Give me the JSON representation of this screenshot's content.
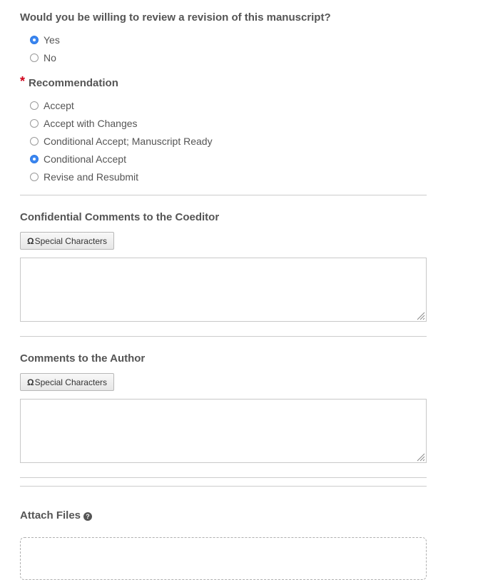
{
  "revision_question": {
    "label": "Would you be willing to review a revision of this manuscript?",
    "options": [
      {
        "label": "Yes",
        "checked": true
      },
      {
        "label": "No",
        "checked": false
      }
    ]
  },
  "recommendation": {
    "required_marker": "*",
    "label": "Recommendation",
    "options": [
      {
        "label": "Accept",
        "checked": false
      },
      {
        "label": "Accept with Changes",
        "checked": false
      },
      {
        "label": "Conditional Accept; Manuscript Ready",
        "checked": false
      },
      {
        "label": "Conditional Accept",
        "checked": true
      },
      {
        "label": "Revise and Resubmit",
        "checked": false
      }
    ]
  },
  "confidential_comments": {
    "label": "Confidential Comments to the Coeditor",
    "special_chars_symbol": "Ω",
    "special_chars_label": "Special Characters",
    "value": ""
  },
  "author_comments": {
    "label": "Comments to the Author",
    "special_chars_symbol": "Ω",
    "special_chars_label": "Special Characters",
    "value": ""
  },
  "attach_files": {
    "label": "Attach Files",
    "help_symbol": "?"
  },
  "colors": {
    "radio_selected": "#3b86f0",
    "required_star": "#d0021b",
    "text": "#555555"
  }
}
